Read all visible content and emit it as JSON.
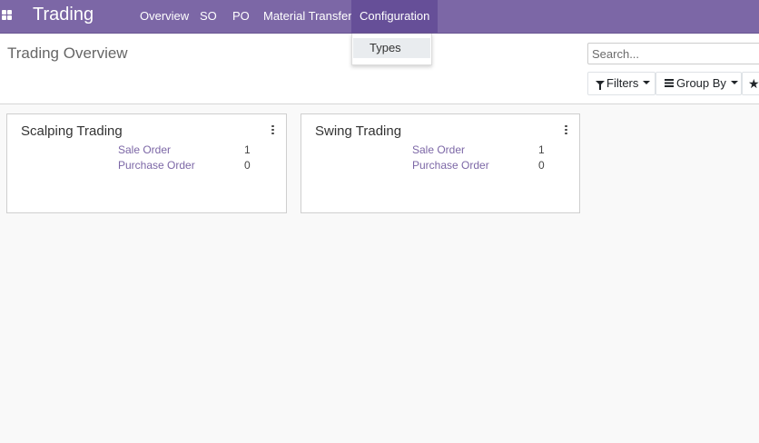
{
  "app": {
    "title": "Trading"
  },
  "navbar": {
    "menu": [
      "Overview",
      "SO",
      "PO",
      "Material Transfer",
      "Configuration"
    ],
    "active": "Configuration"
  },
  "dropdown": {
    "items": [
      "Types"
    ]
  },
  "control_panel": {
    "page_title": "Trading Overview",
    "search_placeholder": "Search...",
    "filters_label": "Filters",
    "groupby_label": "Group By",
    "favorites_icon": "star-icon"
  },
  "cards": [
    {
      "title": "Scalping Trading",
      "stats": [
        {
          "label": "Sale Order",
          "value": "1"
        },
        {
          "label": "Purchase Order",
          "value": "0"
        }
      ]
    },
    {
      "title": "Swing Trading",
      "stats": [
        {
          "label": "Sale Order",
          "value": "1"
        },
        {
          "label": "Purchase Order",
          "value": "0"
        }
      ]
    }
  ],
  "colors": {
    "navbar": "#7c67a6",
    "link": "#7c67a6",
    "active_menu": "#664f98"
  }
}
